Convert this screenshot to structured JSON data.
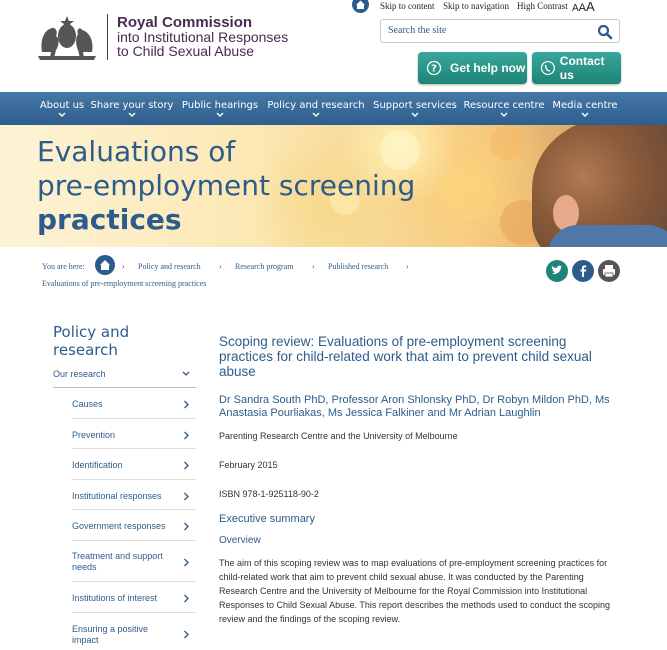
{
  "header": {
    "org_line1": "Royal Commission",
    "org_line2": "into Institutional Responses",
    "org_line3": "to Child Sexual Abuse",
    "skip_content": "Skip to content",
    "skip_navigation": "Skip to navigation",
    "high_contrast": "High Contrast",
    "text_size": "A A A",
    "search_placeholder": "Search the site",
    "help_button": "Get help now",
    "contact_button": "Contact us"
  },
  "nav": {
    "items": [
      "About us",
      "Share your story",
      "Public hearings",
      "Policy and research",
      "Support services",
      "Resource centre",
      "Media centre"
    ]
  },
  "hero": {
    "line1": "Evaluations of",
    "line2": "pre-employment screening",
    "line3": "practices"
  },
  "breadcrumb": {
    "label": "You are here:",
    "items": [
      "Policy and research",
      "Research program",
      "Published research",
      "Evaluations of pre-employment screening practices"
    ]
  },
  "sidebar": {
    "title_line1": "Policy and",
    "title_line2": "research",
    "section": "Our research",
    "items": [
      "Causes",
      "Prevention",
      "Identification",
      "Institutional responses",
      "Government responses",
      "Treatment and support needs",
      "Institutions of interest",
      "Ensuring a positive impact"
    ]
  },
  "main": {
    "title": "Scoping review: Evaluations of pre-employment screening practices for child-related work that aim to prevent child sexual abuse",
    "authors": "Dr Sandra South PhD, Professor Aron Shlonsky PhD, Dr Robyn Mildon PhD, Ms Anastasia Pourliakas, Ms Jessica Falkiner and Mr Adrian Laughlin",
    "publisher": "Parenting Research Centre and the University of Melbourne",
    "date": "February 2015",
    "isbn": "ISBN 978-1-925118-90-2",
    "exec_summary": "Executive summary",
    "overview": "Overview",
    "paragraph": "The aim of this scoping review was to map evaluations of pre-employment screening practices for child-related work that aim to prevent child sexual abuse. It was conducted by the Parenting Research Centre and the University of Melbourne for the Royal Commission into Institutional Responses to Child Sexual Abuse. This report describes the methods used to conduct the scoping review and the findings of the scoping review."
  },
  "colors": {
    "primary": "#2d5c8c",
    "green": "#1e8477",
    "purple": "#4a2a52"
  }
}
